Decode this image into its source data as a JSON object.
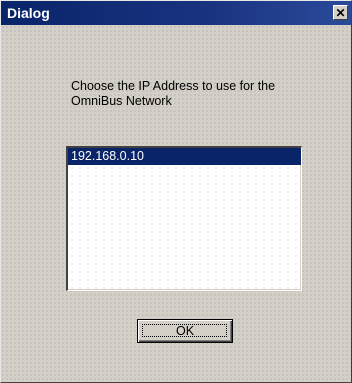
{
  "window": {
    "title": "Dialog",
    "close_glyph": "✕",
    "close_icon": "close-icon"
  },
  "prompt": {
    "line1": "Choose the IP Address to use for the",
    "line2": "OmniBus Network"
  },
  "ip_list": {
    "items": [
      {
        "label": "192.168.0.10",
        "selected": true
      }
    ]
  },
  "buttons": {
    "ok_label": "OK"
  },
  "colors": {
    "titlebar": "#0a246a",
    "selection": "#0a246a",
    "face": "#d4d0c8"
  }
}
